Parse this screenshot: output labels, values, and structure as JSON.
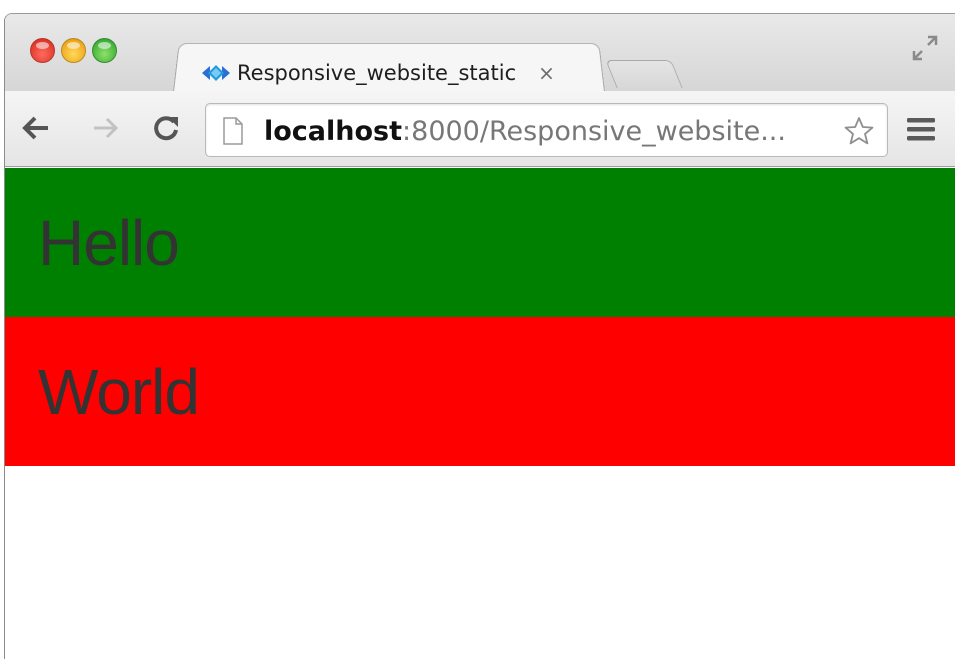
{
  "tab": {
    "title": "Responsive_website_static",
    "close_glyph": "×",
    "favicon": "diamond-arrows-icon"
  },
  "toolbar": {
    "icons": [
      "back-arrow-icon",
      "forward-arrow-icon",
      "reload-icon",
      "page-icon",
      "star-icon",
      "menu-icon"
    ],
    "url_host": "localhost",
    "url_rest": ":8000/Responsive_website..."
  },
  "window_controls": [
    "close-button",
    "minimize-button",
    "zoom-button",
    "fullscreen-icon"
  ],
  "page": {
    "sections": [
      {
        "text": "Hello",
        "background": "#008000"
      },
      {
        "text": "World",
        "background": "#ff0000"
      }
    ],
    "text_color": "#333333"
  }
}
